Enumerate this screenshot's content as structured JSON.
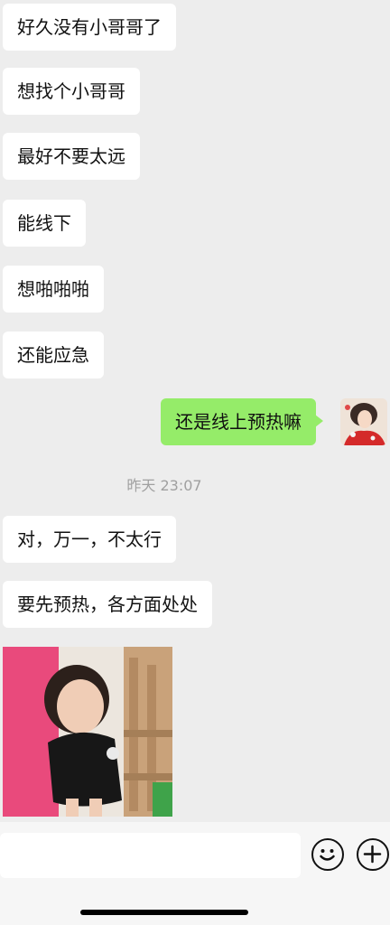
{
  "messages": [
    {
      "text": "好久没有小哥哥了",
      "side": "in"
    },
    {
      "text": "想找个小哥哥",
      "side": "in"
    },
    {
      "text": "最好不要太远",
      "side": "in"
    },
    {
      "text": "能线下",
      "side": "in"
    },
    {
      "text": "想啪啪啪",
      "side": "in"
    },
    {
      "text": "还能应急",
      "side": "in"
    },
    {
      "text": "还是线上预热嘛",
      "side": "out"
    },
    {
      "text": "对，万一，不太行",
      "side": "in"
    },
    {
      "text": "要先预热，各方面处处",
      "side": "in"
    }
  ],
  "timestamp": "昨天 23:07",
  "input": {
    "placeholder": ""
  },
  "icons": {
    "emoji": "smiley-icon",
    "plus": "plus-icon"
  },
  "colors": {
    "outgoing": "#95ec69",
    "incoming": "#ffffff",
    "background": "#ededed"
  }
}
